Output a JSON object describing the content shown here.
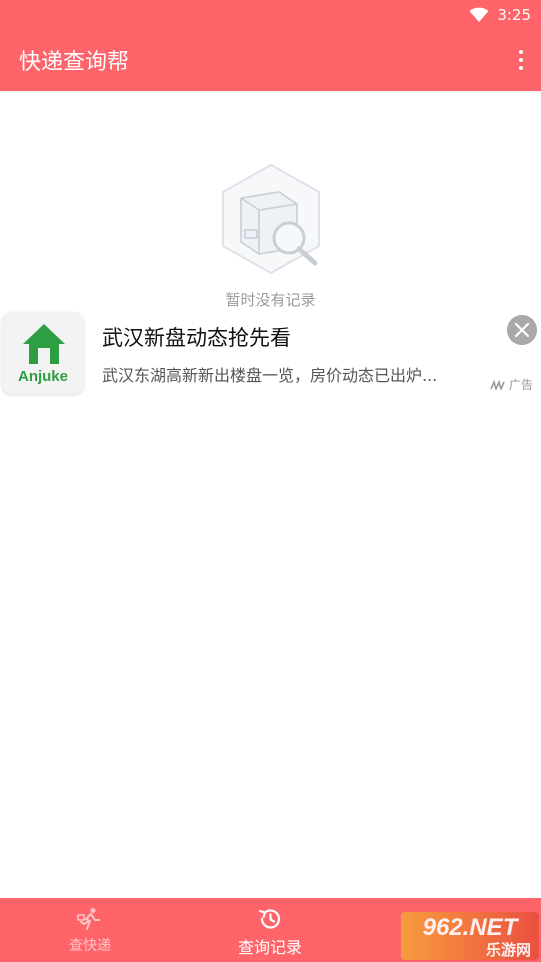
{
  "status_bar": {
    "time": "3:25",
    "wifi_icon": "wifi-icon"
  },
  "app_bar": {
    "title": "快递查询帮",
    "menu_icon": "more-vert-icon"
  },
  "empty_state": {
    "icon": "package-search-icon",
    "text": "暂时没有记录"
  },
  "ad": {
    "logo_text": "Anjuke",
    "logo_icon": "house-icon",
    "title": "武汉新盘动态抢先看",
    "description": "武汉东湖高新新出楼盘一览，房价动态已出炉...",
    "close_icon": "close-icon",
    "ad_label": "广告"
  },
  "bottom_nav": [
    {
      "label": "查快递",
      "icon": "running-courier-icon",
      "active": false
    },
    {
      "label": "查询记录",
      "icon": "history-icon",
      "active": true
    }
  ],
  "watermark": {
    "top": "962.NET",
    "bottom": "乐游网"
  },
  "colors": {
    "primary": "#ff646a",
    "empty_text": "#9a9a9a",
    "brand_green": "#2e9e43"
  }
}
